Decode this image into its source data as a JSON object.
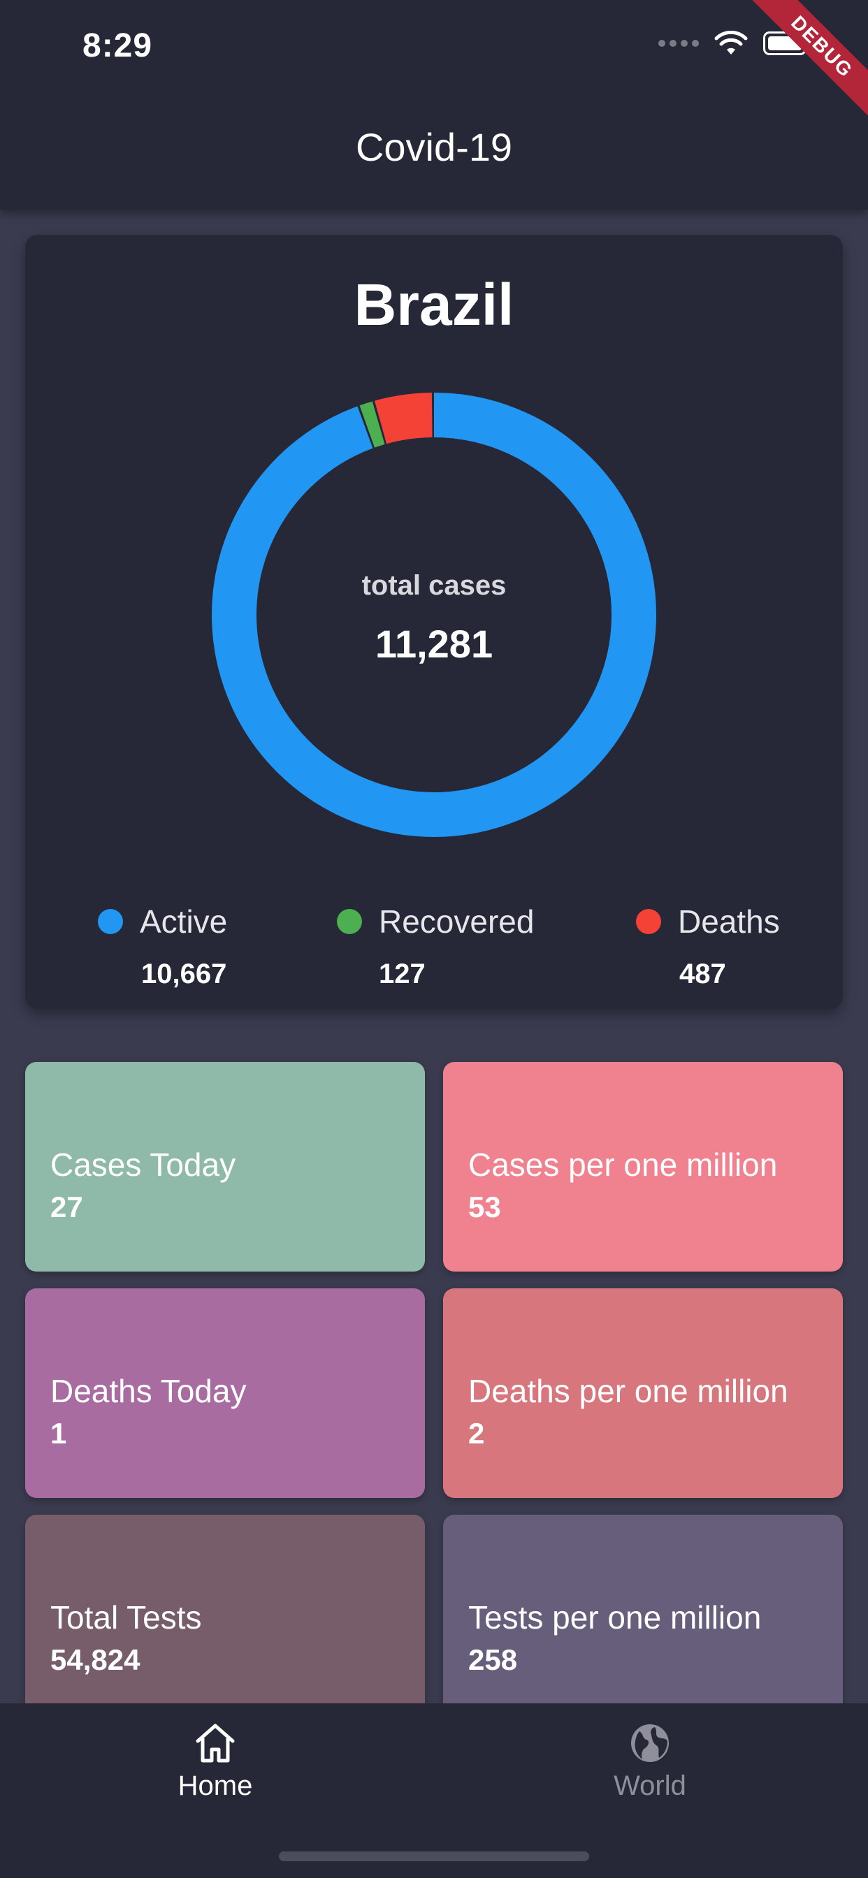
{
  "status_bar": {
    "time": "8:29",
    "debug_label": "DEBUG"
  },
  "app_title": "Covid-19",
  "summary": {
    "country": "Brazil",
    "total_label": "total cases",
    "total_value": "11,281",
    "legend": [
      {
        "name": "Active",
        "value": "10,667",
        "color": "#2196f3"
      },
      {
        "name": "Recovered",
        "value": "127",
        "color": "#4caf50"
      },
      {
        "name": "Deaths",
        "value": "487",
        "color": "#f44336"
      }
    ]
  },
  "chart_data": {
    "type": "pie",
    "labels": [
      "Active",
      "Recovered",
      "Deaths"
    ],
    "values": [
      10667,
      127,
      487
    ],
    "colors": [
      "#2196f3",
      "#4caf50",
      "#f44336"
    ]
  },
  "stats": [
    {
      "label": "Cases Today",
      "value": "27",
      "color": "#8fb9a8"
    },
    {
      "label": "Cases per one million",
      "value": "53",
      "color": "#f0818e"
    },
    {
      "label": "Deaths Today",
      "value": "1",
      "color": "#a86ca1"
    },
    {
      "label": "Deaths per one million",
      "value": "2",
      "color": "#d7767d"
    },
    {
      "label": "Total Tests",
      "value": "54,824",
      "color": "#765d69"
    },
    {
      "label": "Tests per one million",
      "value": "258",
      "color": "#675e7b"
    }
  ],
  "nav": {
    "home": {
      "label": "Home",
      "icon": "home-icon"
    },
    "world": {
      "label": "World",
      "icon": "globe-icon"
    }
  }
}
